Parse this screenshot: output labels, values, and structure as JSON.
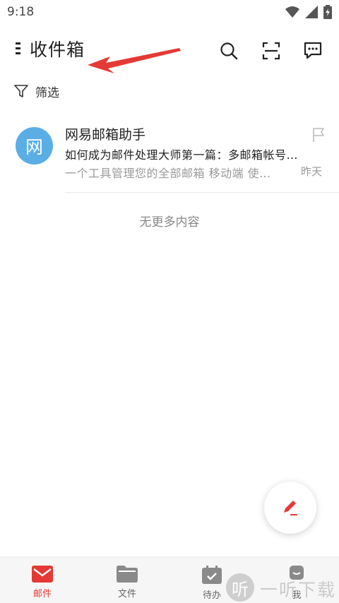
{
  "status_bar": {
    "time": "9:18"
  },
  "app_bar": {
    "title": "收件箱"
  },
  "filter": {
    "label": "筛选"
  },
  "mail_list": [
    {
      "avatar_text": "网",
      "sender": "网易邮箱助手",
      "subject": "如何成为邮件处理大师第一篇：多邮箱帐号…",
      "preview": "一个工具管理您的全部邮箱 移动端 使…",
      "date": "昨天"
    }
  ],
  "list_footer": "无更多内容",
  "tabs": [
    {
      "label": "邮件",
      "icon": "mail-icon",
      "active": true
    },
    {
      "label": "文件",
      "icon": "folder-icon",
      "active": false
    },
    {
      "label": "待办",
      "icon": "todo-icon",
      "active": false
    },
    {
      "label": "我",
      "icon": "profile-icon",
      "active": false
    }
  ],
  "watermark": {
    "logo_char": "听",
    "text": "一听下载"
  },
  "colors": {
    "accent": "#e53935",
    "avatar": "#5aaee5",
    "arrow": "#e53935"
  }
}
